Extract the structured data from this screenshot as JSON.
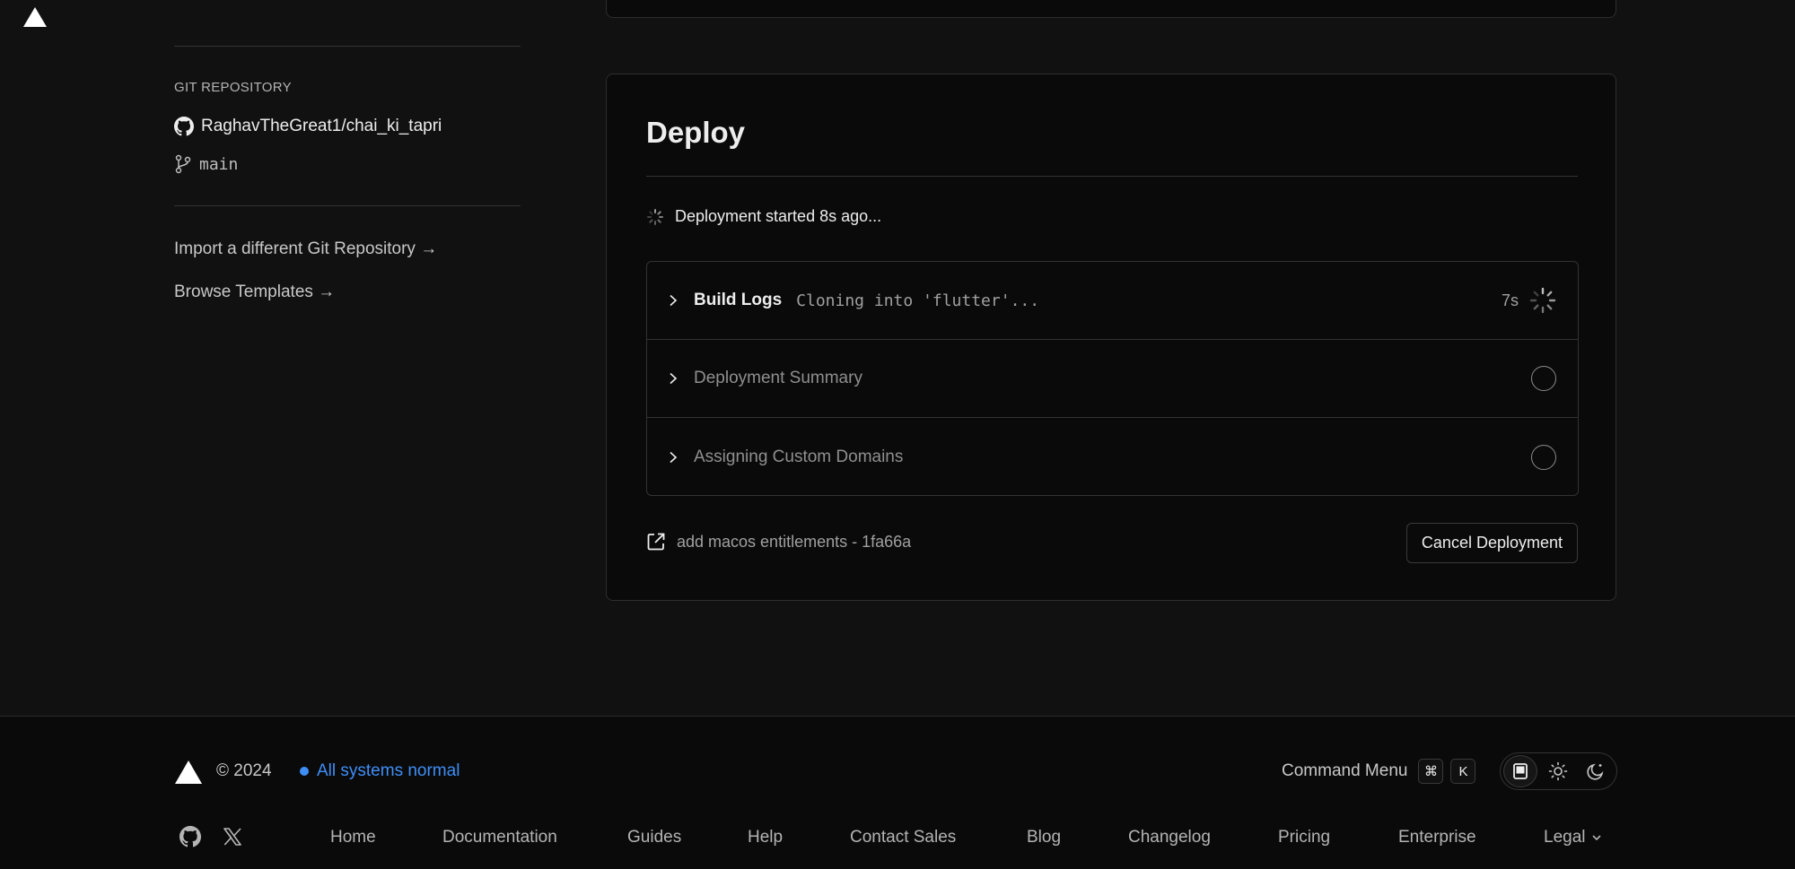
{
  "left": {
    "section_label": "GIT REPOSITORY",
    "repo_name": "RaghavTheGreat1/chai_ki_tapri",
    "branch": "main",
    "import_link": "Import a different Git Repository →",
    "templates_link": "Browse Templates →"
  },
  "deploy": {
    "title": "Deploy",
    "status_text": "Deployment started 8s ago...",
    "steps": [
      {
        "name": "Build Logs",
        "log": "Cloning into 'flutter'...",
        "time": "7s",
        "state": "running"
      },
      {
        "name": "Deployment Summary",
        "state": "pending"
      },
      {
        "name": "Assigning Custom Domains",
        "state": "pending"
      }
    ],
    "commit": "add macos entitlements - 1fa66a",
    "cancel_label": "Cancel Deployment"
  },
  "footer": {
    "copyright": "© 2024",
    "status": "All systems normal",
    "status_color": "#3e8ef7",
    "command_menu": "Command Menu",
    "kbd_1": "⌘",
    "kbd_2": "K",
    "theme_options": [
      "system-icon",
      "sun-icon",
      "moon-icon"
    ],
    "nav": [
      "Home",
      "Documentation",
      "Guides",
      "Help",
      "Contact Sales",
      "Blog",
      "Changelog",
      "Pricing",
      "Enterprise",
      "Legal"
    ]
  }
}
